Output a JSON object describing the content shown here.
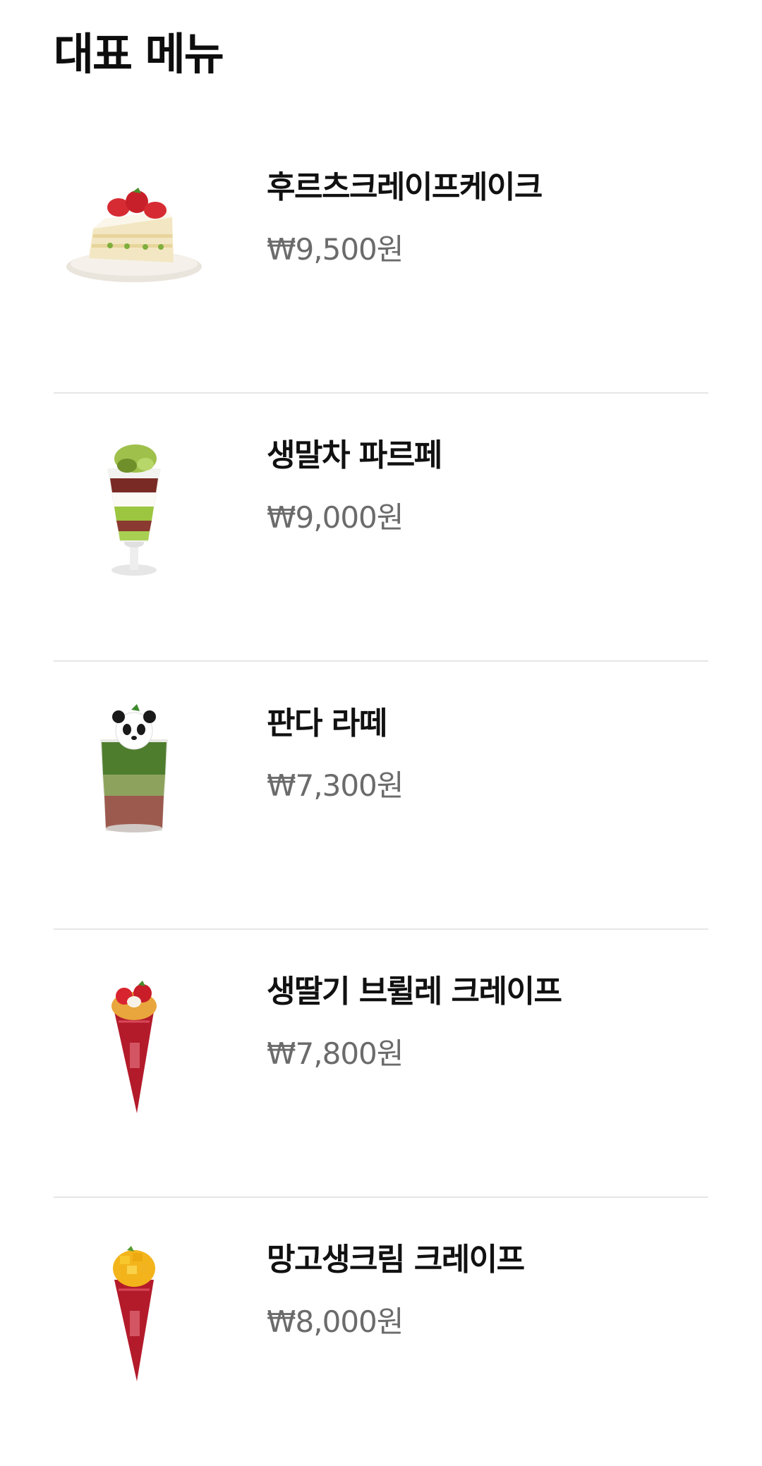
{
  "section": {
    "title": "대표 메뉴"
  },
  "menu": [
    {
      "name": "후르츠크레이프케이크",
      "price": "₩9,500원",
      "icon": "strawberry-crepe-cake-icon"
    },
    {
      "name": "생말차 파르페",
      "price": "₩9,000원",
      "icon": "matcha-parfait-icon"
    },
    {
      "name": "판다 라떼",
      "price": "₩7,300원",
      "icon": "panda-latte-icon"
    },
    {
      "name": "생딸기 브륄레 크레이프",
      "price": "₩7,800원",
      "icon": "strawberry-brulee-crepe-icon"
    },
    {
      "name": "망고생크림 크레이프",
      "price": "₩8,000원",
      "icon": "mango-cream-crepe-icon"
    }
  ]
}
